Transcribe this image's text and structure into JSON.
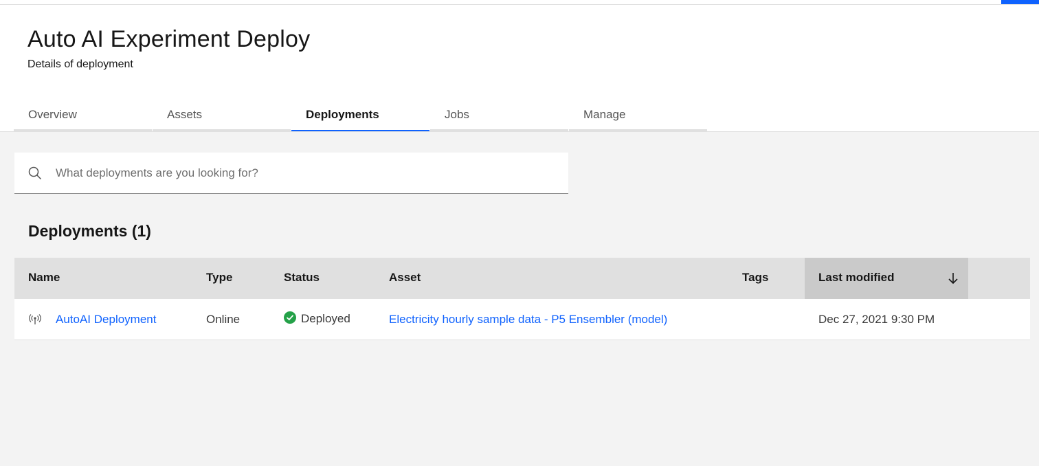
{
  "header": {
    "title": "Auto AI Experiment Deploy",
    "subtitle": "Details of deployment"
  },
  "tabs": [
    {
      "label": "Overview",
      "active": false
    },
    {
      "label": "Assets",
      "active": false
    },
    {
      "label": "Deployments",
      "active": true
    },
    {
      "label": "Jobs",
      "active": false
    },
    {
      "label": "Manage",
      "active": false
    }
  ],
  "search": {
    "placeholder": "What deployments are you looking for?",
    "value": ""
  },
  "deployments": {
    "section_title": "Deployments (1)",
    "columns": {
      "name": "Name",
      "type": "Type",
      "status": "Status",
      "asset": "Asset",
      "tags": "Tags",
      "last_modified": "Last modified"
    },
    "sort": {
      "column": "last_modified",
      "direction": "descending",
      "icon": "arrow-down-icon"
    },
    "rows": [
      {
        "icon": "deployment-online-icon",
        "name": "AutoAI Deployment",
        "type": "Online",
        "status": "Deployed",
        "status_icon": "checkmark-filled-icon",
        "asset": "Electricity hourly sample data - P5 Ensembler (model)",
        "tags": "",
        "last_modified": "Dec 27, 2021 9:30 PM"
      }
    ]
  },
  "colors": {
    "accent": "#0f62fe",
    "success": "#24a148",
    "page_background": "#f3f3f3",
    "header_row": "#e0e0e0"
  }
}
